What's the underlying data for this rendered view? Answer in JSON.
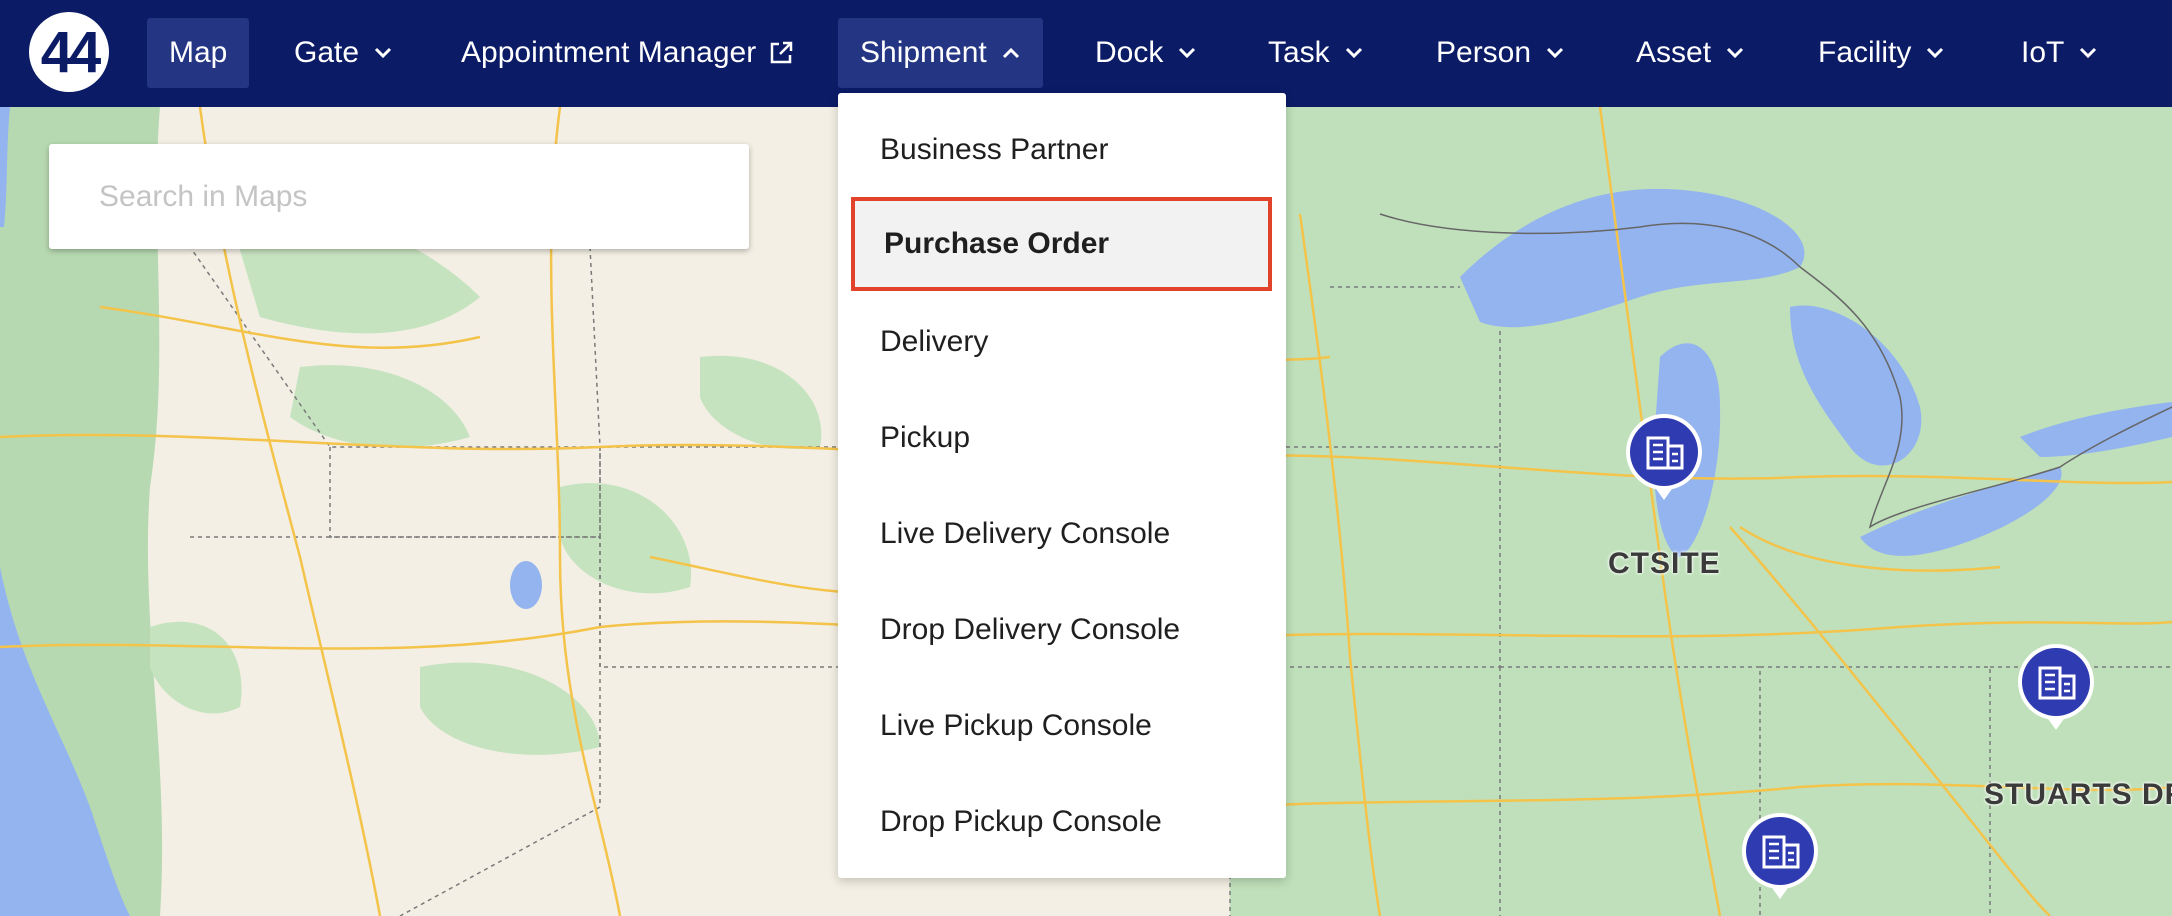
{
  "brand": {
    "logo_text": "44"
  },
  "nav": {
    "map": "Map",
    "gate": "Gate",
    "appointment_manager": "Appointment Manager",
    "shipment": "Shipment",
    "dock": "Dock",
    "task": "Task",
    "person": "Person",
    "asset": "Asset",
    "facility": "Facility",
    "iot": "IoT"
  },
  "search": {
    "placeholder": "Search in Maps"
  },
  "shipment_menu": {
    "items": [
      "Business Partner",
      "Purchase Order",
      "Delivery",
      "Pickup",
      "Live Delivery Console",
      "Drop Delivery Console",
      "Live Pickup Console",
      "Drop Pickup Console"
    ],
    "highlighted": "Purchase Order"
  },
  "map_labels": {
    "ctsite": "CTSITE",
    "stuarts": "STUARTS DR"
  },
  "colors": {
    "nav_bg": "#0b1b66",
    "nav_active": "#243584",
    "marker": "#2f3bb0",
    "highlight_border": "#e0432a",
    "water": "#94b4f0",
    "land": "#f3efe4",
    "forest": "#b8dcb4"
  },
  "icons": [
    "external-link-icon",
    "chevron-down-icon",
    "chevron-up-icon",
    "building-icon"
  ]
}
